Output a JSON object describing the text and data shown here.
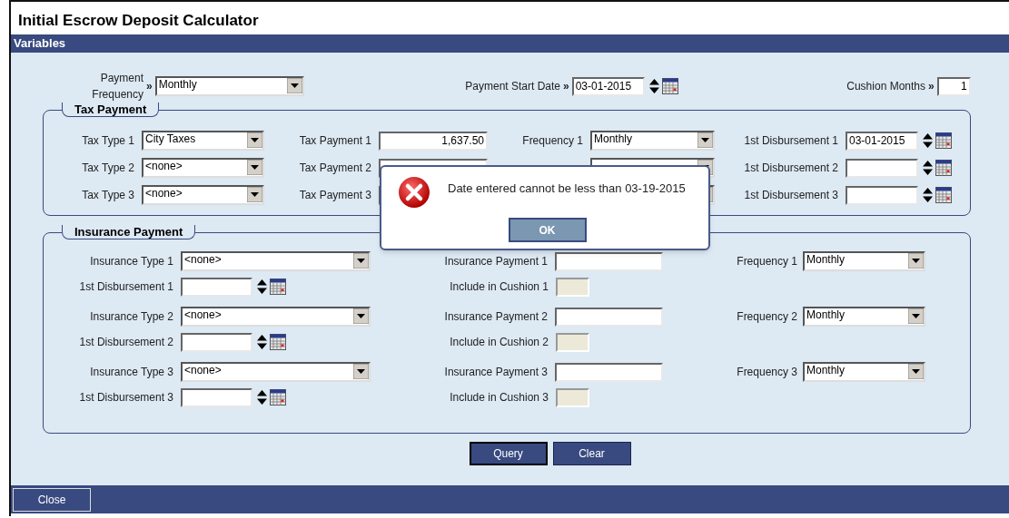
{
  "window": {
    "title": "Initial Escrow Deposit Calculator"
  },
  "section_title": "Variables",
  "top_fields": {
    "payment_frequency": {
      "label": "Payment Frequency",
      "value": "Monthly"
    },
    "payment_start_date": {
      "label": "Payment Start Date",
      "value": "03-01-2015"
    },
    "cushion_months": {
      "label": "Cushion Months",
      "value": "1"
    },
    "arrow": "»"
  },
  "tax_payment": {
    "legend": "Tax Payment",
    "rows": [
      {
        "type_label": "Tax Type 1",
        "type_value": "City Taxes",
        "payment_label": "Tax Payment 1",
        "payment_value": "1,637.50",
        "frequency_label": "Frequency 1",
        "frequency_value": "Monthly",
        "disbursement_label": "1st Disbursement 1",
        "disbursement_value": "03-01-2015"
      },
      {
        "type_label": "Tax Type 2",
        "type_value": "<none>",
        "payment_label": "Tax Payment 2",
        "disbursement_label": "1st Disbursement 2"
      },
      {
        "type_label": "Tax Type 3",
        "type_value": "<none>",
        "payment_label": "Tax Payment 3",
        "disbursement_label": "1st Disbursement 3"
      }
    ]
  },
  "insurance_payment": {
    "legend": "Insurance Payment",
    "rows": [
      {
        "type_label": "Insurance Type 1",
        "type_value": "<none>",
        "payment_label": "Insurance Payment 1",
        "frequency_label": "Frequency 1",
        "frequency_value": "Monthly",
        "disbursement_label": "1st Disbursement 1",
        "cushion_label": "Include in Cushion 1",
        "cushion_disabled": true
      },
      {
        "type_label": "Insurance Type 2",
        "type_value": "<none>",
        "payment_label": "Insurance Payment 2",
        "frequency_label": "Frequency 2",
        "frequency_value": "Monthly",
        "disbursement_label": "1st Disbursement 2",
        "cushion_label": "Include in Cushion 2",
        "cushion_disabled": true
      },
      {
        "type_label": "Insurance Type 3",
        "type_value": "<none>",
        "payment_label": "Insurance Payment 3",
        "frequency_label": "Frequency 3",
        "frequency_value": "Monthly",
        "disbursement_label": "1st Disbursement 3",
        "cushion_label": "Include in Cushion 3",
        "cushion_disabled": true
      }
    ]
  },
  "buttons": [
    {
      "label": "Query",
      "focused": true
    },
    {
      "label": "Clear",
      "focused": false
    }
  ],
  "footer": {
    "close_button": "Close"
  },
  "dialog": {
    "kind": "error",
    "message": "Date entered cannot be less than 03-19-2015",
    "ok_button": "OK"
  }
}
